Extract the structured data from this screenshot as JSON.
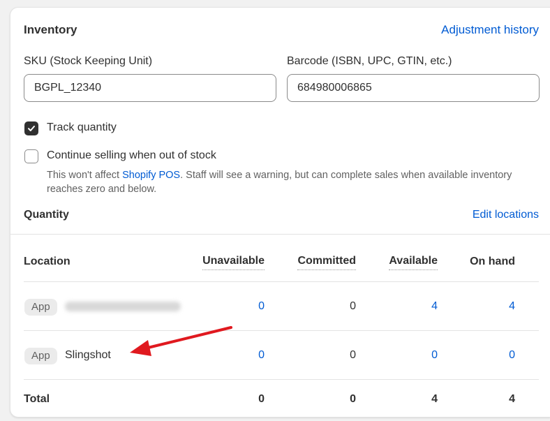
{
  "inventory": {
    "title": "Inventory",
    "adjustment_history": "Adjustment history",
    "sku": {
      "label": "SKU (Stock Keeping Unit)",
      "value": "BGPL_12340"
    },
    "barcode": {
      "label": "Barcode (ISBN, UPC, GTIN, etc.)",
      "value": "684980006865"
    },
    "track_quantity": {
      "label": "Track quantity",
      "checked": true
    },
    "continue_selling": {
      "label": "Continue selling when out of stock",
      "checked": false
    },
    "help": {
      "prefix": "This won't affect ",
      "link": "Shopify POS",
      "suffix": ". Staff will see a warning, but can complete sales when available inventory reaches zero and below."
    }
  },
  "quantity": {
    "title": "Quantity",
    "edit_locations": "Edit locations",
    "headers": {
      "location": "Location",
      "unavailable": "Unavailable",
      "committed": "Committed",
      "available": "Available",
      "on_hand": "On hand"
    },
    "rows": [
      {
        "badge": "App",
        "name": "",
        "name_blurred": true,
        "unavailable": "0",
        "committed": "0",
        "available": "4",
        "on_hand": "4"
      },
      {
        "badge": "App",
        "name": "Slingshot",
        "name_blurred": false,
        "unavailable": "0",
        "committed": "0",
        "available": "0",
        "on_hand": "0"
      }
    ],
    "total": {
      "label": "Total",
      "unavailable": "0",
      "committed": "0",
      "available": "4",
      "on_hand": "4"
    }
  },
  "colors": {
    "link": "#005bd3",
    "annotation_arrow": "#e0191f"
  }
}
